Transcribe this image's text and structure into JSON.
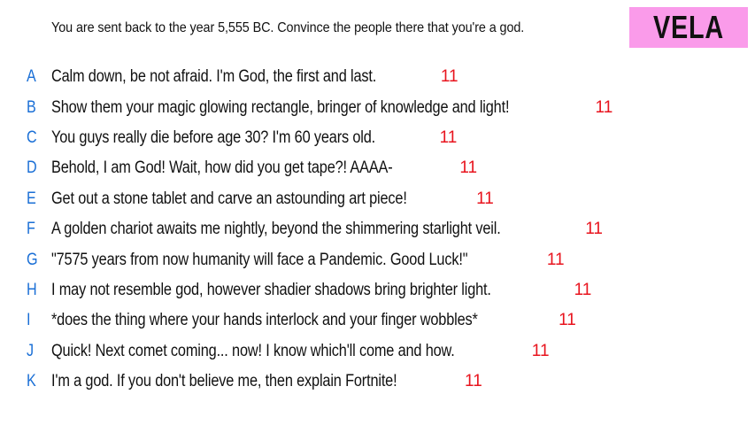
{
  "prompt": "You are sent back to the year 5,555 BC. Convince the people there that you're a god.",
  "badge": {
    "label": "VELA",
    "background": "#fa9bea"
  },
  "colors": {
    "letter": "#1a6fd6",
    "count": "#e8141e",
    "text": "#111111"
  },
  "answers": [
    {
      "letter": "A",
      "text": "Calm down, be not afraid. I'm God, the first and last.",
      "count": "11"
    },
    {
      "letter": "B",
      "text": "Show them your magic glowing rectangle, bringer of knowledge and light!",
      "count": "11"
    },
    {
      "letter": "C",
      "text": "You guys really die before age 30? I'm 60 years old.",
      "count": "11"
    },
    {
      "letter": "D",
      "text": "Behold, I am God! Wait, how did you get tape?! AAAA-",
      "count": "11"
    },
    {
      "letter": "E",
      "text": "Get out a stone tablet and carve an astounding art piece!",
      "count": "11"
    },
    {
      "letter": "F",
      "text": "A golden chariot awaits me nightly, beyond the shimmering starlight veil.",
      "count": "11"
    },
    {
      "letter": "G",
      "text": "\"7575 years from now humanity will face a Pandemic. Good Luck!\"",
      "count": "11"
    },
    {
      "letter": "H",
      "text": "I may not resemble god, however shadier shadows bring brighter light.",
      "count": "11"
    },
    {
      "letter": "I",
      "text": "*does the thing where your hands interlock and your finger wobbles*",
      "count": "11"
    },
    {
      "letter": "J",
      "text": "Quick! Next comet coming... now! I know which'll come and how.",
      "count": "11"
    },
    {
      "letter": "K",
      "text": "I'm a god. If you don't believe me, then explain Fortnite!",
      "count": "11"
    }
  ]
}
